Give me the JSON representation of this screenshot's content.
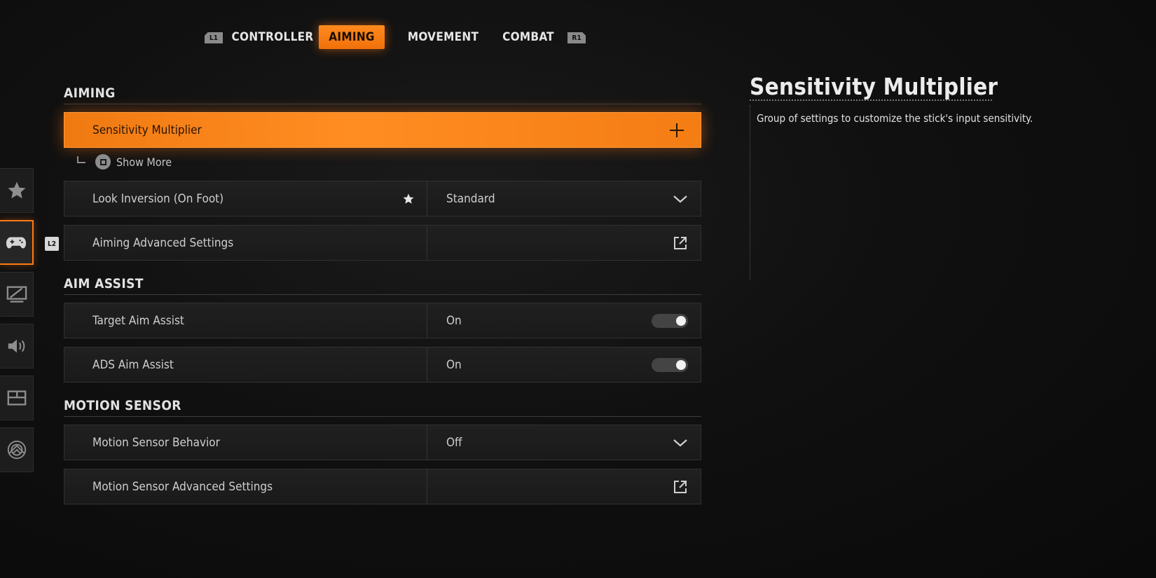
{
  "top_tabs": {
    "left_bumper": "L1",
    "right_bumper": "R1",
    "tabs": [
      {
        "label": "CONTROLLER",
        "active": false
      },
      {
        "label": "AIMING",
        "active": true
      },
      {
        "label": "MOVEMENT",
        "active": false
      },
      {
        "label": "COMBAT",
        "active": false
      }
    ]
  },
  "side_rail": {
    "trigger_badge": "L2",
    "items": [
      {
        "icon": "star-icon",
        "active": false
      },
      {
        "icon": "gamepad-icon",
        "active": true
      },
      {
        "icon": "display-icon",
        "active": false
      },
      {
        "icon": "speaker-icon",
        "active": false
      },
      {
        "icon": "interface-icon",
        "active": false
      },
      {
        "icon": "network-icon",
        "active": false
      }
    ]
  },
  "sections": {
    "aiming": {
      "header": "AIMING",
      "sensitivity_multiplier": "Sensitivity Multiplier",
      "show_more": "Show More",
      "look_inversion": {
        "label": "Look Inversion (On Foot)",
        "value": "Standard"
      },
      "aiming_advanced": "Aiming Advanced Settings"
    },
    "aim_assist": {
      "header": "AIM ASSIST",
      "target_aim_assist": {
        "label": "Target Aim Assist",
        "value": "On"
      },
      "ads_aim_assist": {
        "label": "ADS Aim Assist",
        "value": "On"
      }
    },
    "motion_sensor": {
      "header": "MOTION SENSOR",
      "behavior": {
        "label": "Motion Sensor Behavior",
        "value": "Off"
      },
      "advanced": "Motion Sensor Advanced Settings"
    }
  },
  "description": {
    "title": "Sensitivity Multiplier",
    "text": "Group of settings to customize the stick's input sensitivity."
  },
  "colors": {
    "accent": "#ff7a14",
    "background": "#0c0c0c",
    "row": "#1d1d1d"
  }
}
